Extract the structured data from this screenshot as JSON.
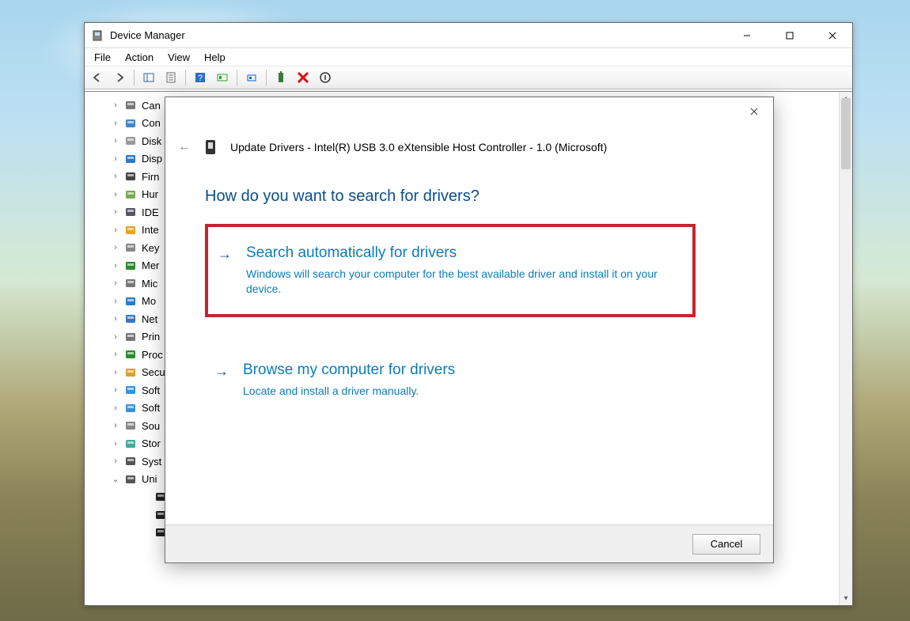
{
  "window": {
    "title": "Device Manager",
    "menus": [
      "File",
      "Action",
      "View",
      "Help"
    ],
    "toolbar": [
      "nav-back",
      "nav-forward",
      "sep",
      "show-hide-tree",
      "properties",
      "sep",
      "help",
      "refresh",
      "sep",
      "update-driver",
      "sep",
      "enable-device",
      "disable-device",
      "uninstall-device"
    ]
  },
  "tree": {
    "items": [
      {
        "label": "Can",
        "icon": "camera",
        "expand": ">"
      },
      {
        "label": "Con",
        "icon": "computer",
        "expand": ">"
      },
      {
        "label": "Disk",
        "icon": "disk",
        "expand": ">"
      },
      {
        "label": "Disp",
        "icon": "display",
        "expand": ">"
      },
      {
        "label": "Firn",
        "icon": "firmware",
        "expand": ">"
      },
      {
        "label": "Hur",
        "icon": "hid",
        "expand": ">"
      },
      {
        "label": "IDE",
        "icon": "ide",
        "expand": ">"
      },
      {
        "label": "Inte",
        "icon": "card",
        "expand": ">"
      },
      {
        "label": "Key",
        "icon": "keyboard",
        "expand": ">"
      },
      {
        "label": "Mer",
        "icon": "memory",
        "expand": ">"
      },
      {
        "label": "Mic",
        "icon": "mouse",
        "expand": ">"
      },
      {
        "label": "Mo",
        "icon": "monitor",
        "expand": ">"
      },
      {
        "label": "Net",
        "icon": "network",
        "expand": ">"
      },
      {
        "label": "Prin",
        "icon": "printer",
        "expand": ">"
      },
      {
        "label": "Proc",
        "icon": "processor",
        "expand": ">"
      },
      {
        "label": "Secu",
        "icon": "security",
        "expand": ">"
      },
      {
        "label": "Soft",
        "icon": "software1",
        "expand": ">"
      },
      {
        "label": "Soft",
        "icon": "software2",
        "expand": ">"
      },
      {
        "label": "Sou",
        "icon": "sound",
        "expand": ">"
      },
      {
        "label": "Stor",
        "icon": "storage",
        "expand": ">"
      },
      {
        "label": "Syst",
        "icon": "system",
        "expand": ">"
      },
      {
        "label": "Uni",
        "icon": "usb",
        "expand": "v"
      }
    ],
    "children": [
      {
        "icon": "usb-device"
      },
      {
        "icon": "usb-device"
      },
      {
        "icon": "usb-device"
      }
    ]
  },
  "dialog": {
    "title": "Update Drivers - Intel(R) USB 3.0 eXtensible Host Controller - 1.0 (Microsoft)",
    "question": "How do you want to search for drivers?",
    "option1": {
      "title": "Search automatically for drivers",
      "desc": "Windows will search your computer for the best available driver and install it on your device."
    },
    "option2": {
      "title": "Browse my computer for drivers",
      "desc": "Locate and install a driver manually."
    },
    "cancel": "Cancel"
  }
}
